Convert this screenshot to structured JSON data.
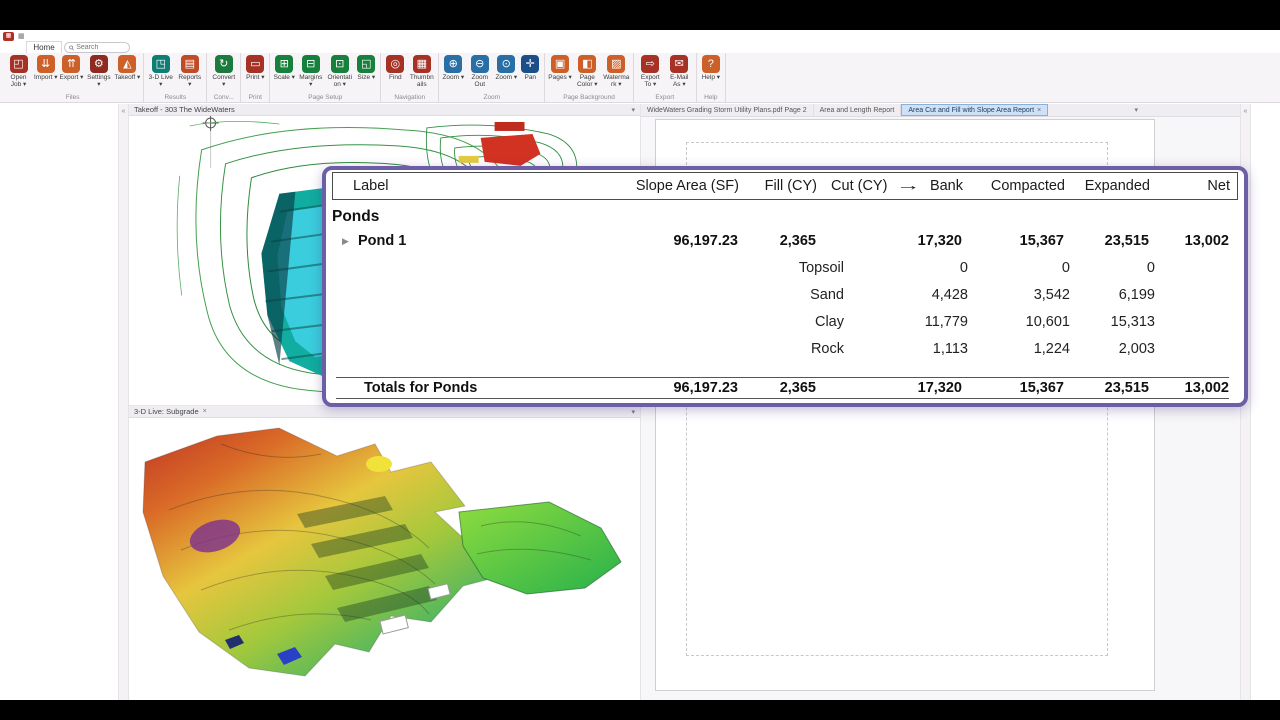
{
  "app": {
    "home_tab": "Home",
    "search_placeholder": "Search",
    "caret": "▾",
    "close_glyph": "×",
    "collapse_glyph": "«",
    "expander": "▶"
  },
  "ribbon": {
    "groups": [
      {
        "label": "Files",
        "buttons": [
          {
            "label": "Open Job",
            "glyph": "◰",
            "color": "#a63226",
            "dd": true
          },
          {
            "label": "Import",
            "glyph": "⇊",
            "color": "#cd5f28",
            "dd": true
          },
          {
            "label": "Export",
            "glyph": "⇈",
            "color": "#cd5f28",
            "dd": true
          },
          {
            "label": "Settings",
            "glyph": "⚙",
            "color": "#8f2a20",
            "dd": true
          },
          {
            "label": "Takeoff",
            "glyph": "◭",
            "color": "#cd5f28",
            "dd": true
          }
        ]
      },
      {
        "label": "Results",
        "buttons": [
          {
            "label": "3-D Live",
            "glyph": "◳",
            "color": "#0e7d74",
            "dd": true
          },
          {
            "label": "Reports",
            "glyph": "▤",
            "color": "#bf4b27",
            "dd": true
          }
        ]
      },
      {
        "label": "Conv...",
        "buttons": [
          {
            "label": "Convert",
            "glyph": "↻",
            "color": "#1d7a3e",
            "dd": true
          }
        ]
      },
      {
        "label": "Print",
        "buttons": [
          {
            "label": "Print",
            "glyph": "▭",
            "color": "#a63226",
            "dd": true
          }
        ]
      },
      {
        "label": "Page Setup",
        "buttons": [
          {
            "label": "Scale",
            "glyph": "⊞",
            "color": "#16803c",
            "dd": true
          },
          {
            "label": "Margins",
            "glyph": "⊟",
            "color": "#16803c",
            "dd": true
          },
          {
            "label": "Orientation",
            "glyph": "⊡",
            "color": "#16803c",
            "dd": true
          },
          {
            "label": "Size",
            "glyph": "◱",
            "color": "#16803c",
            "dd": true
          }
        ]
      },
      {
        "label": "Navigation",
        "buttons": [
          {
            "label": "Find",
            "glyph": "◎",
            "color": "#a63226",
            "dd": false
          },
          {
            "label": "Thumbnails",
            "glyph": "▦",
            "color": "#a63226",
            "dd": false
          }
        ]
      },
      {
        "label": "Zoom",
        "buttons": [
          {
            "label": "Zoom",
            "glyph": "⊕",
            "color": "#2a6ea6",
            "dd": true
          },
          {
            "label": "Zoom Out",
            "glyph": "⊖",
            "color": "#2a6ea6",
            "dd": false
          },
          {
            "label": "Zoom",
            "glyph": "⊙",
            "color": "#2a6ea6",
            "dd": true
          },
          {
            "label": "Pan",
            "glyph": "✛",
            "color": "#1c4f8a",
            "dd": false
          }
        ]
      },
      {
        "label": "Page Background",
        "buttons": [
          {
            "label": "Pages",
            "glyph": "▣",
            "color": "#cd5f28",
            "dd": true
          },
          {
            "label": "Page Color",
            "glyph": "◧",
            "color": "#cd5f28",
            "dd": true
          },
          {
            "label": "Watermark",
            "glyph": "▨",
            "color": "#cd5f28",
            "dd": true
          }
        ]
      },
      {
        "label": "Export",
        "buttons": [
          {
            "label": "Export To",
            "glyph": "⇨",
            "color": "#a63226",
            "dd": true
          },
          {
            "label": "E-Mail As",
            "glyph": "✉",
            "color": "#a63226",
            "dd": true
          }
        ]
      },
      {
        "label": "Help",
        "buttons": [
          {
            "label": "Help",
            "glyph": "?",
            "color": "#cd5f28",
            "dd": true
          }
        ]
      }
    ]
  },
  "left_panel": {
    "takeoff_title": "Takeoff - 303 The WideWaters",
    "live_title": "3-D Live: Subgrade"
  },
  "right_panel": {
    "tabs": [
      {
        "label": "WideWaters Grading Storm Utility Plans.pdf Page 2"
      },
      {
        "label": "Area and Length Report"
      },
      {
        "label": "Area Cut and Fill with Slope Area Report"
      }
    ]
  },
  "report": {
    "columns": {
      "label": "Label",
      "slope_area": "Slope Area (SF)",
      "fill": "Fill (CY)",
      "cut": "Cut (CY)",
      "arrow": "→",
      "bank": "Bank",
      "compacted": "Compacted",
      "expanded": "Expanded",
      "net": "Net"
    },
    "section": "Ponds",
    "pond_row": {
      "label": "Pond 1",
      "slope_area": "96,197.23",
      "fill": "2,365",
      "bank": "17,320",
      "compacted": "15,367",
      "expanded": "23,515",
      "net": "13,002"
    },
    "material_rows": [
      {
        "label": "Topsoil",
        "bank": "0",
        "compacted": "0",
        "expanded": "0"
      },
      {
        "label": "Sand",
        "bank": "4,428",
        "compacted": "3,542",
        "expanded": "6,199"
      },
      {
        "label": "Clay",
        "bank": "11,779",
        "compacted": "10,601",
        "expanded": "15,313"
      },
      {
        "label": "Rock",
        "bank": "1,113",
        "compacted": "1,224",
        "expanded": "2,003"
      }
    ],
    "totals_row": {
      "label": "Totals for Ponds",
      "slope_area": "96,197.23",
      "fill": "2,365",
      "bank": "17,320",
      "compacted": "15,367",
      "expanded": "23,515",
      "net": "13,002"
    }
  },
  "colors": {
    "popup_border": "#6d5fa5",
    "active_tab": "#cfe1f6"
  }
}
